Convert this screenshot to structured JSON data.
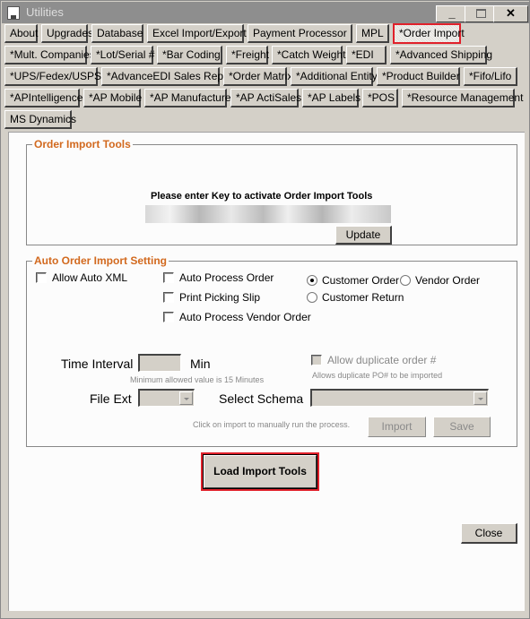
{
  "window": {
    "title": "Utilities",
    "controls": {
      "minimize": "_",
      "close": "✕"
    }
  },
  "tabs": [
    [
      {
        "label": "About"
      },
      {
        "label": "Upgrades"
      },
      {
        "label": "Database"
      },
      {
        "label": "Excel Import/Export"
      },
      {
        "label": "Payment Processor"
      },
      {
        "label": "MPL"
      },
      {
        "label": "*Order Import",
        "active": true
      }
    ],
    [
      {
        "label": "*Mult. Companies"
      },
      {
        "label": "*Lot/Serial #"
      },
      {
        "label": "*Bar Coding"
      },
      {
        "label": "*Freight"
      },
      {
        "label": "*Catch Weights"
      },
      {
        "label": "*EDI"
      },
      {
        "label": "*Advanced Shipping"
      }
    ],
    [
      {
        "label": "*UPS/Fedex/USPS"
      },
      {
        "label": "*AdvanceEDI Sales Rep."
      },
      {
        "label": "*Order Matrix"
      },
      {
        "label": "*Additional Entity"
      },
      {
        "label": "*Product Builder"
      },
      {
        "label": "*Fifo/Lifo"
      }
    ],
    [
      {
        "label": "*APIntelligence"
      },
      {
        "label": "*AP Mobile"
      },
      {
        "label": "*AP Manufacture"
      },
      {
        "label": "*AP ActiSales"
      },
      {
        "label": "*AP Labels"
      },
      {
        "label": "*POS"
      },
      {
        "label": "*Resource Management"
      }
    ],
    [
      {
        "label": "MS Dynamics"
      }
    ]
  ],
  "order_import_tools": {
    "title": "Order Import Tools",
    "prompt": "Please enter Key  to activate Order Import Tools",
    "key_value": "",
    "update_label": "Update"
  },
  "auto_settings": {
    "title": "Auto Order Import Setting",
    "allow_auto_xml": {
      "label": "Allow Auto XML",
      "checked": false
    },
    "auto_process_order": {
      "label": "Auto Process Order",
      "checked": false
    },
    "print_picking_slip": {
      "label": "Print Picking Slip",
      "checked": false
    },
    "auto_process_vendor_order": {
      "label": "Auto Process Vendor Order",
      "checked": false
    },
    "order_type": {
      "options": [
        "Customer Order",
        "Vendor Order",
        "Customer Return"
      ],
      "selected": "Customer Order"
    },
    "time_interval": {
      "label": "Time Interval",
      "value": "",
      "unit": "Min",
      "hint": "Minimum allowed value is 15 Minutes"
    },
    "allow_duplicate": {
      "label": "Allow duplicate order #",
      "checked": false,
      "hint": "Allows duplicate PO# to be imported"
    },
    "file_ext": {
      "label": "File Ext",
      "value": ""
    },
    "select_schema": {
      "label": "Select Schema",
      "value": ""
    },
    "manual_hint": "Click on import to manually run the process.",
    "import_label": "Import",
    "save_label": "Save"
  },
  "load_import_tools_label": "Load Import Tools",
  "close_label": "Close",
  "colors": {
    "accent_red": "#e0202a",
    "group_title": "#d2691e",
    "face": "#d4d0c8"
  }
}
